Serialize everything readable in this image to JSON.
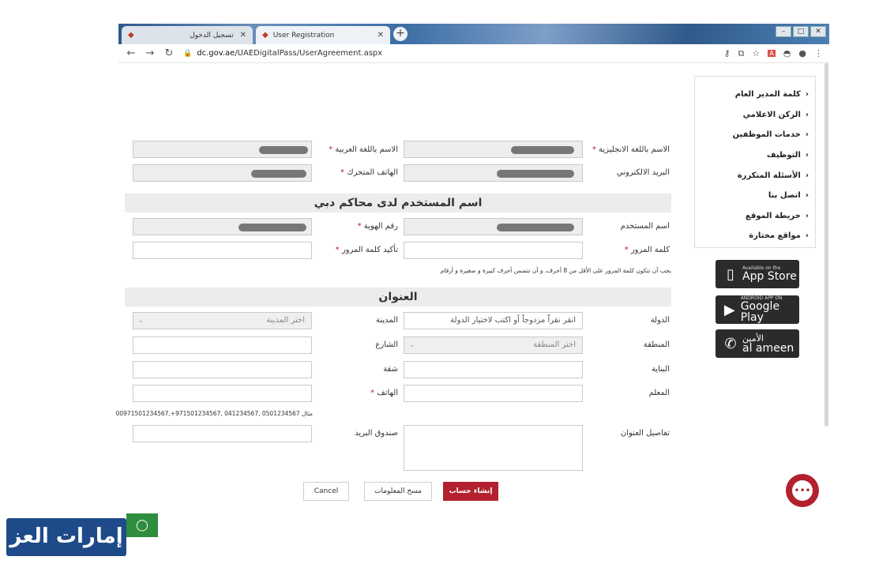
{
  "browser": {
    "tabs": [
      {
        "label": "تسجيل الدخول",
        "active": false
      },
      {
        "label": "User Registration",
        "active": true
      }
    ],
    "url_host": "dc.gov.ae",
    "url_path": "/UAEDigitalPass/UserAgreement.aspx"
  },
  "form": {
    "name_en_label": "الاسم باللغة الانجليزية",
    "name_ar_label": "الاسم باللغة العربية",
    "email_label": "البريد الالكتروني",
    "mobile_label": "الهاتف المتحرك",
    "username_section": "اسم المستخدم لدى محاكم دبي",
    "username_label": "اسم المستخدم",
    "emirates_id_label": "رقم الهوية",
    "password_label": "كلمة المرور",
    "confirm_password_label": "تأكيد كلمة المرور",
    "password_note": "يجب أن تتكون كلمة المرور على الأقل من 8 أحرف، و أن تتضمن أحرف كبيرة و صغيرة و أرقام",
    "address_section": "العنوان",
    "country_label": "الدولة",
    "country_placeholder": "انقر نقراً مزدوجاً أو اكتب لاختيار الدولة",
    "city_label": "المدينة",
    "city_placeholder": "اختر المدينة",
    "area_label": "المنطقة",
    "area_placeholder": "اختر المنطقة",
    "street_label": "الشارع",
    "building_label": "البناية",
    "flat_label": "شقة",
    "landmark_label": "المعلم",
    "phone_label": "الهاتف",
    "phone_example": "مثال 0501234567 ,041234567 ,971501234567+,00971501234567",
    "address_details_label": "تفاصيل العنوان",
    "po_box_label": "صندوق البريد",
    "required_mark": "*"
  },
  "buttons": {
    "create": "إنشاء حساب",
    "clear": "مسح المعلومات",
    "cancel": "Cancel"
  },
  "sidebar": {
    "items": [
      "كلمة المدير العام",
      "الركن الاعلامي",
      "خدمات الموظفين",
      "التوظيف",
      "الأسئلة المتكررة",
      "اتصل بنا",
      "خريطة الموقع",
      "مواقع مختارة"
    ]
  },
  "stores": {
    "appstore_small": "Available on the",
    "appstore_big": "App Store",
    "googleplay_small": "ANDROID APP ON",
    "googleplay_big": "Google Play",
    "alameen_ar": "الأمين",
    "alameen_en": "al ameen"
  },
  "watermark": "إمارات العز",
  "colors": {
    "accent": "#b3202e",
    "section_bg": "#ececec"
  }
}
